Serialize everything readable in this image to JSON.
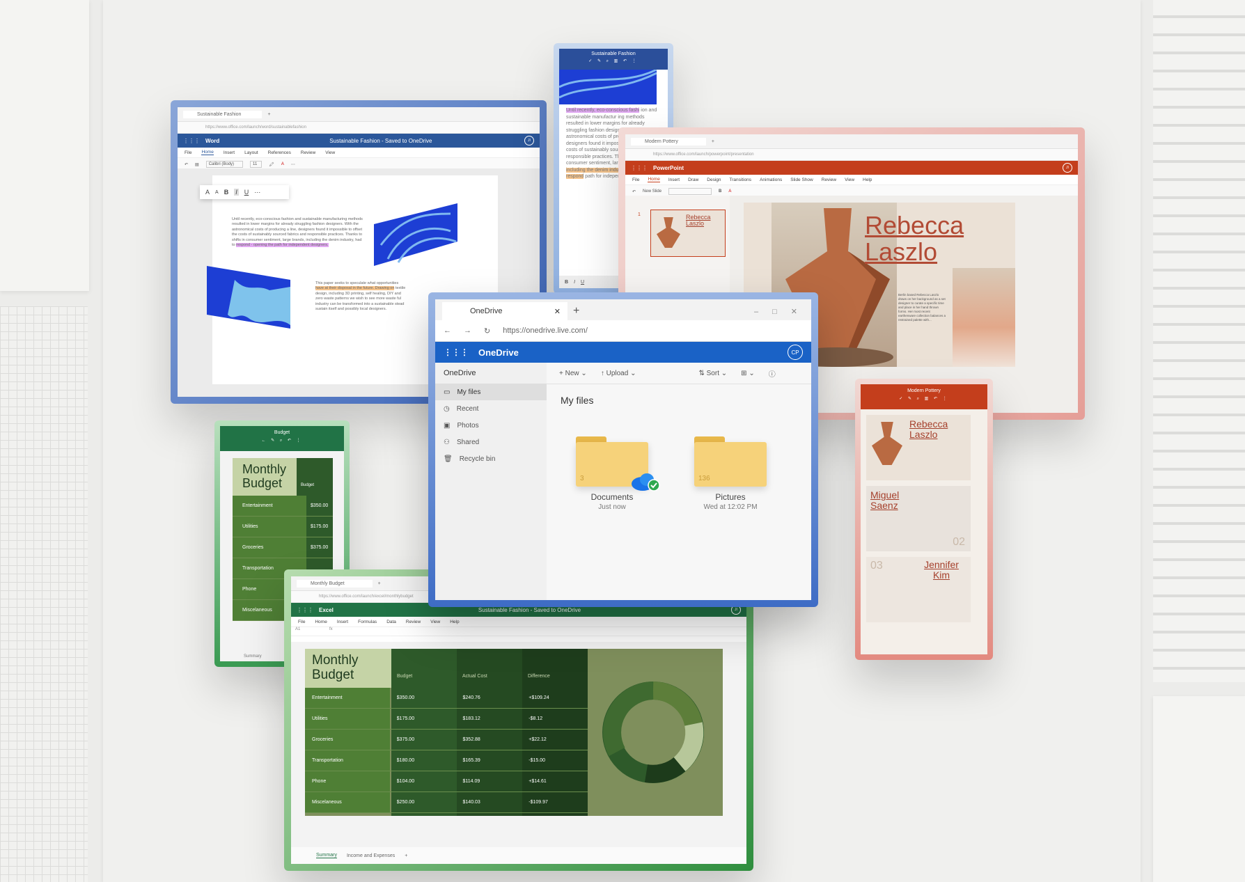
{
  "word": {
    "tab_title": "Sustainable Fashion",
    "app_name": "Word",
    "doc_title": "Sustainable Fashion - Saved to OneDrive",
    "menu": [
      "File",
      "Home",
      "Insert",
      "Layout",
      "References",
      "Review",
      "View"
    ],
    "font_name": "Calibri (Body)",
    "font_size": "11",
    "user_initials": "JI",
    "para1": "Until recently, eco-conscious fashion and sustainable manufacturing methods resulted in lower margins for already struggling fashion designers. With the astronomical costs of producing a line, designers found it impossible to offset the costs of sustainably sourced fabrics and responsible practices. Thanks to shifts in consumer sentiment, large brands, including the denim industry, had to",
    "para1_highlight": "respond - opening the path for independent designers.",
    "para2": "This paper seeks to speculate what opportunities",
    "para2_highlight": "have at their disposal in the future. Drawing on",
    "para2_rest": "textile design, including 3D printing, self healing, DIY and zero waste patterns we wish to see more waste ful industry can be transformed into a sustainable stead sustain itself and possibly local designers."
  },
  "word_mobile": {
    "title": "Sustainable Fashion",
    "highlight": "Until recently, eco-conscious fashi",
    "body": "ion and sustainable manufactur ing methods resulted in lower margins for already struggling fashion designers. With astronomical costs of producing a line, designers found it impossible to offset the costs of sustainably sourced fabrics and responsible practices. Thanks to shifts in consumer sentiment, large brands,",
    "highlight2": "including the denim industry, have had to respond",
    "tail": "path for independent designers."
  },
  "powerpoint": {
    "tab_title": "Modern Pottery",
    "app_name": "PowerPoint",
    "menu": [
      "File",
      "Home",
      "Insert",
      "Draw",
      "Design",
      "Transitions",
      "Animations",
      "Slide Show",
      "Review",
      "View",
      "Help"
    ],
    "new_slide": "New Slide",
    "slide_number": "1",
    "thumb_title": "Rebecca Laszlo",
    "slide_title_line1": "Rebecca",
    "slide_title_line2": "Laszlo",
    "slide_body": "Berlin based Rebecca Laszlo draws on her background as a set designer to curate a specific time and place in her hand thrown forms. Her most recent earthenware collection balances a restrained palette with...",
    "user_initials": "JI"
  },
  "pottery_mobile": {
    "title": "Modern Pottery",
    "slides": [
      {
        "name": "Rebecca Laszlo",
        "num": ""
      },
      {
        "name": "Miguel Saenz",
        "num": "02"
      },
      {
        "name": "Jennifer Kim",
        "num": "03"
      }
    ]
  },
  "onedrive": {
    "tab_title": "OneDrive",
    "url": "https://onedrive.live.com/",
    "app_name": "OneDrive",
    "user_initials": "CP",
    "sidebar_header": "OneDrive",
    "nav": [
      "My files",
      "Recent",
      "Photos",
      "Shared",
      "Recycle bin"
    ],
    "cmd_new": "New",
    "cmd_upload": "Upload",
    "cmd_sort": "Sort",
    "page_title": "My files",
    "folders": [
      {
        "name": "Documents",
        "count": "3",
        "modified": "Just now"
      },
      {
        "name": "Pictures",
        "count": "136",
        "modified": "Wed at 12:02 PM"
      }
    ]
  },
  "budget_mobile": {
    "title": "Budget",
    "heading": "Monthly Budget",
    "col_header": "Budget",
    "rows": [
      {
        "label": "Entertainment",
        "value": "$350.00"
      },
      {
        "label": "Utilities",
        "value": "$175.00"
      },
      {
        "label": "Groceries",
        "value": "$375.00"
      },
      {
        "label": "Transportation",
        "value": ""
      },
      {
        "label": "Phone",
        "value": ""
      },
      {
        "label": "Miscelaneous",
        "value": ""
      }
    ],
    "sheet_tab": "Summary"
  },
  "excel": {
    "tab_title": "Monthly Budget",
    "app_name": "Excel",
    "doc_title": "Sustainable Fashion - Saved to OneDrive",
    "menu": [
      "File",
      "Home",
      "Insert",
      "Formulas",
      "Data",
      "Review",
      "View",
      "Help"
    ],
    "cell_ref": "A1",
    "heading": "Monthly Budget",
    "headers": [
      "Budget",
      "Actual Cost",
      "Difference"
    ],
    "rows": [
      {
        "label": "Entertainment",
        "budget": "$350.00",
        "actual": "$240.76",
        "diff": "+$109.24"
      },
      {
        "label": "Utilities",
        "budget": "$175.00",
        "actual": "$183.12",
        "diff": "-$8.12"
      },
      {
        "label": "Groceries",
        "budget": "$375.00",
        "actual": "$352.88",
        "diff": "+$22.12"
      },
      {
        "label": "Transportation",
        "budget": "$180.00",
        "actual": "$165.39",
        "diff": "-$15.00"
      },
      {
        "label": "Phone",
        "budget": "$104.00",
        "actual": "$114.09",
        "diff": "+$14.61"
      },
      {
        "label": "Miscelaneous",
        "budget": "$250.00",
        "actual": "$140.03",
        "diff": "-$109.97"
      }
    ],
    "sheet_tabs": [
      "Summary",
      "Income and Expenses"
    ],
    "user_initials": "JI"
  },
  "colors": {
    "word_blue": "#2b579a",
    "onedrive_blue": "#1a62c6",
    "ppt_red": "#c43e1c",
    "excel_green": "#217346",
    "terracotta": "#b96a42"
  }
}
